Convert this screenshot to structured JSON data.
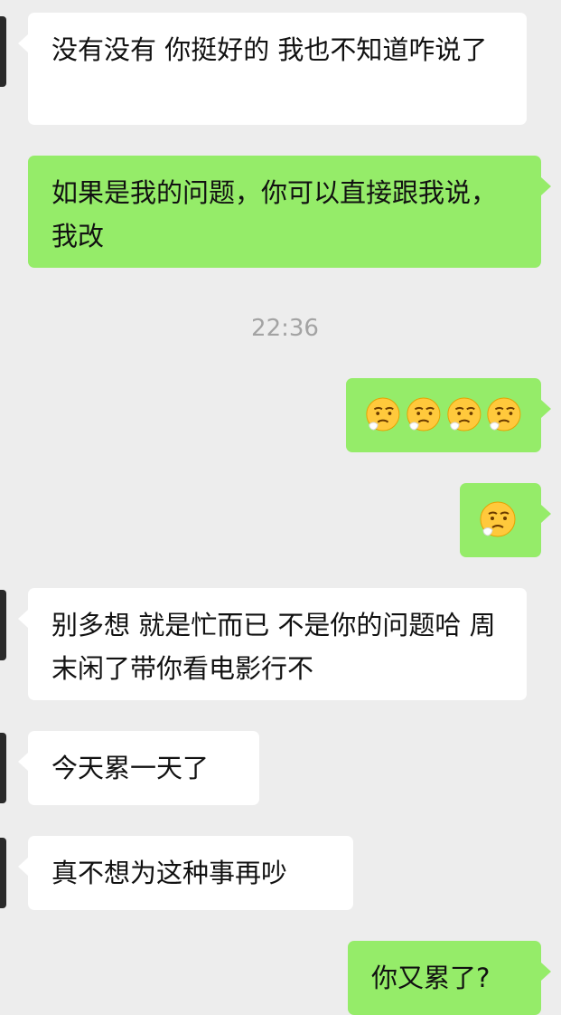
{
  "chat": {
    "messages": [
      {
        "side": "in",
        "text": "没有没有 你挺好的 我也不知道咋说了"
      },
      {
        "side": "out",
        "text": "如果是我的问题，你可以直接跟我说，我改"
      },
      {
        "side": "out",
        "emoji": "sad-sweat-emoji",
        "count": 4
      },
      {
        "side": "out",
        "emoji": "sad-sweat-emoji",
        "count": 1
      },
      {
        "side": "in",
        "text": "别多想 就是忙而已 不是你的问题哈 周末闲了带你看电影行不"
      },
      {
        "side": "in",
        "text": "今天累一天了"
      },
      {
        "side": "in",
        "text": "真不想为这种事再吵"
      },
      {
        "side": "out",
        "text": "你又累了?"
      }
    ],
    "timestamp": "22:36"
  },
  "colors": {
    "background": "#ededed",
    "incoming_bubble": "#ffffff",
    "outgoing_bubble": "#95ec69",
    "text": "#111111",
    "timestamp": "#a3a3a3"
  }
}
